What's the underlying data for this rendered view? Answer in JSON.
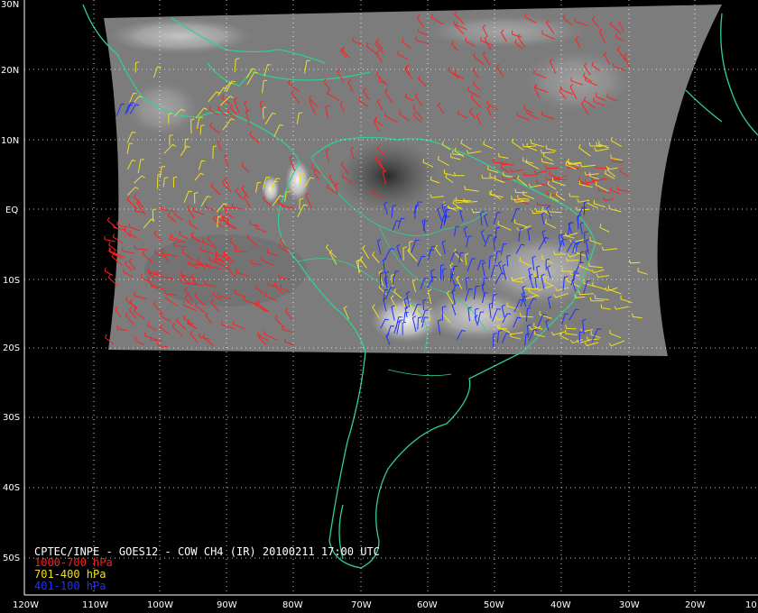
{
  "title": "CPTEC/INPE - GOES12 - COW CH4 (IR) 20100211 17:00 UTC",
  "legend": [
    {
      "label": "1000-700 hPa",
      "color": "#ff2020"
    },
    {
      "label": "701-400 hPa",
      "color": "#f0e020"
    },
    {
      "label": "401-100 hPa",
      "color": "#2030ff"
    }
  ],
  "coast_color": "#30d090",
  "lat_labels": [
    "30N",
    "20N",
    "10N",
    "EQ",
    "10S",
    "20S",
    "30S",
    "40S",
    "50S"
  ],
  "lon_labels": [
    "120W",
    "110W",
    "100W",
    "90W",
    "80W",
    "70W",
    "60W",
    "50W",
    "40W",
    "30W",
    "20W",
    "10"
  ]
}
